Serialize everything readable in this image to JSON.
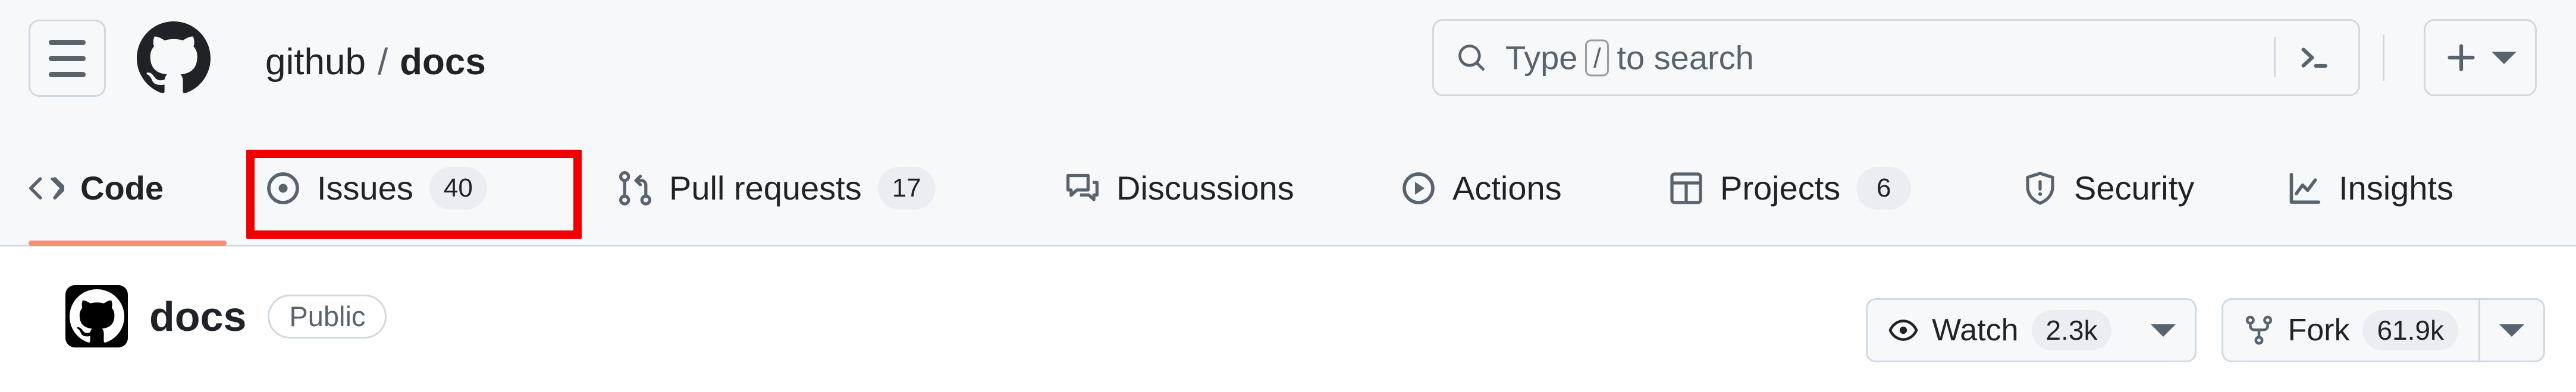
{
  "topbar": {
    "menu_icon": "hamburger-icon",
    "logo_icon": "github-mark-icon",
    "breadcrumb": {
      "owner": "github",
      "separator": "/",
      "repo": "docs"
    },
    "search": {
      "icon": "search-icon",
      "placeholder_prefix": "Type",
      "placeholder_key": "/",
      "placeholder_suffix": "to search",
      "terminal_icon": "terminal-icon"
    },
    "create": {
      "plus_icon": "plus-icon",
      "caret_icon": "chevron-down-icon"
    }
  },
  "nav": {
    "tabs": [
      {
        "label": "Code",
        "icon": "code-icon",
        "count": null,
        "active": true
      },
      {
        "label": "Issues",
        "icon": "issue-opened-icon",
        "count": "40",
        "active": false
      },
      {
        "label": "Pull requests",
        "icon": "git-pull-request-icon",
        "count": "17",
        "active": false
      },
      {
        "label": "Discussions",
        "icon": "comment-discussion-icon",
        "count": null,
        "active": false
      },
      {
        "label": "Actions",
        "icon": "play-icon",
        "count": null,
        "active": false
      },
      {
        "label": "Projects",
        "icon": "table-icon",
        "count": "6",
        "active": false
      },
      {
        "label": "Security",
        "icon": "shield-icon",
        "count": null,
        "active": false
      },
      {
        "label": "Insights",
        "icon": "graph-icon",
        "count": null,
        "active": false
      }
    ],
    "highlight": {
      "target": "Issues",
      "color": "#ee0000"
    },
    "active_underline_color": "#fd8c73"
  },
  "repo": {
    "avatar_icon": "github-mark-icon",
    "name": "docs",
    "visibility": "Public",
    "actions": [
      {
        "label": "Watch",
        "icon": "eye-icon",
        "count": "2.3k",
        "caret": "chevron-down-icon",
        "caret_divided": false
      },
      {
        "label": "Fork",
        "icon": "repo-forked-icon",
        "count": "61.9k",
        "caret": "chevron-down-icon",
        "caret_divided": true
      }
    ]
  },
  "colors": {
    "header_bg": "#f6f8fa",
    "page_bg": "#ffffff",
    "border": "#d1d9e0",
    "text": "#1f2328",
    "muted_text": "#59636e",
    "counter_bg": "#eaeef2",
    "accent_underline": "#fd8c73",
    "highlight_red": "#ee0000"
  }
}
